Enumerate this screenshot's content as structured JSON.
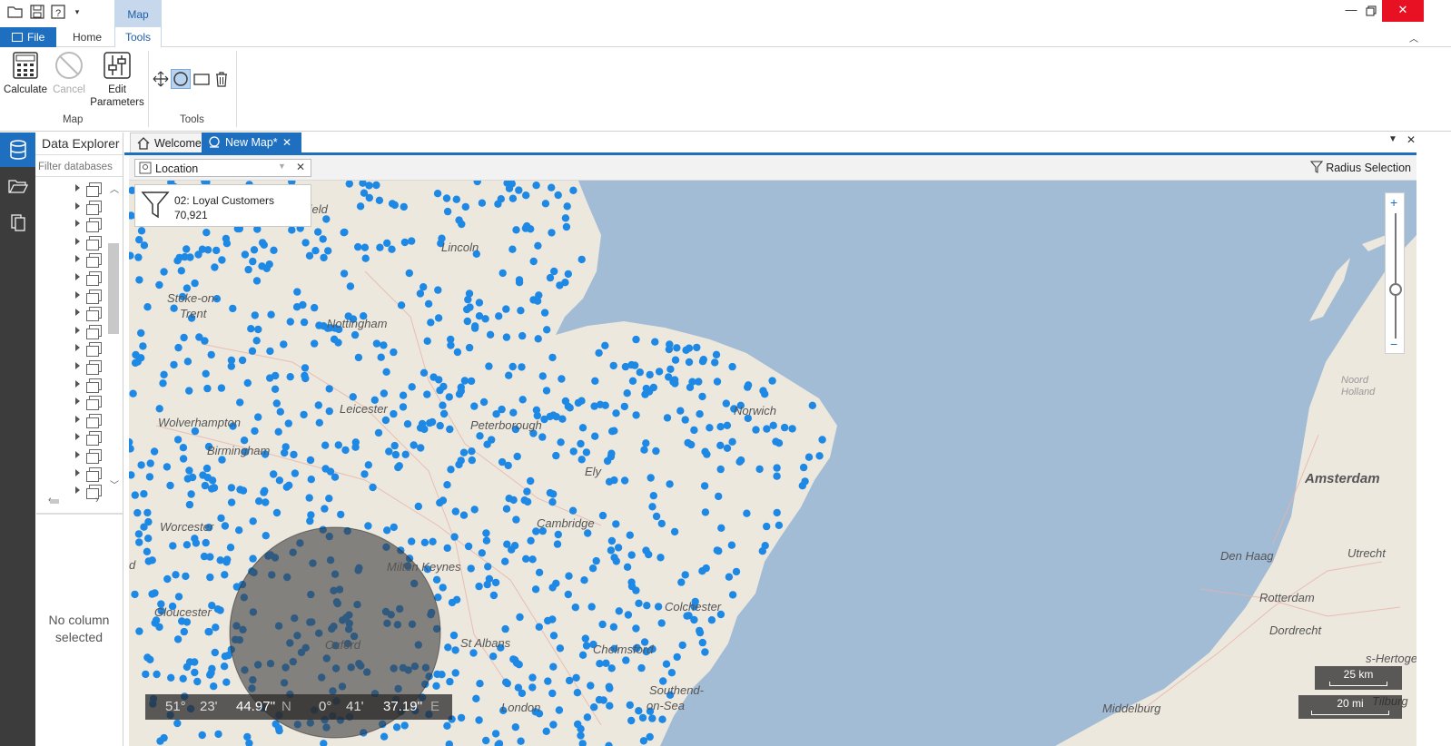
{
  "quick_access": {
    "icons": [
      "open-folder-icon",
      "save-icon",
      "help-icon",
      "customize-dropdown-icon"
    ]
  },
  "contextual_tab": {
    "label": "Map"
  },
  "ribbon_tabs": {
    "file": "File",
    "home": "Home",
    "tools": "Tools"
  },
  "ribbon": {
    "calculate": "Calculate",
    "cancel": "Cancel",
    "edit_parameters_line1": "Edit",
    "edit_parameters_line2": "Parameters",
    "group_map": "Map",
    "group_tools": "Tools"
  },
  "explorer": {
    "title": "Data Explorer",
    "filter_placeholder": "Filter databases",
    "no_column_line1": "No column",
    "no_column_line2": "selected"
  },
  "doc_tabs": {
    "welcome": "Welcome",
    "new_map": "New Map*"
  },
  "map_toolbar": {
    "location": "Location",
    "radius_selection": "Radius Selection"
  },
  "filter_card": {
    "name": "02: Loyal Customers",
    "count": "70,921"
  },
  "map_labels": [
    "field",
    "Lincoln",
    "Stoke-on-",
    "Trent",
    "Nottingham",
    "Leicester",
    "Peterborough",
    "Norwich",
    "Wolverhampton",
    "Birmingham",
    "Ely",
    "Worcester",
    "Cambridge",
    "Milton Keynes",
    "Gloucester",
    "Colchester",
    "Oxford",
    "Chelmsford",
    "St Albans",
    "London",
    "Southend-",
    "on-Sea",
    "Amsterdam",
    "Den Haag",
    "Utrecht",
    "Rotterdam",
    "Dordrecht",
    "s-Hertoge",
    "Tilburg",
    "Middelburg",
    "Noord",
    "Holland",
    "d"
  ],
  "coords": {
    "lat_deg": "51°",
    "lat_min": "23'",
    "lat_sec": "44.97''",
    "lat_dir": "N",
    "lon_deg": "0°",
    "lon_min": "41'",
    "lon_sec": "37.19''",
    "lon_dir": "E"
  },
  "scale": {
    "km": "25 km",
    "mi": "20 mi"
  },
  "colors": {
    "accent": "#1e6fc0",
    "dot": "#1e88e5",
    "water": "#a2bcd6",
    "land": "#ede8de"
  }
}
